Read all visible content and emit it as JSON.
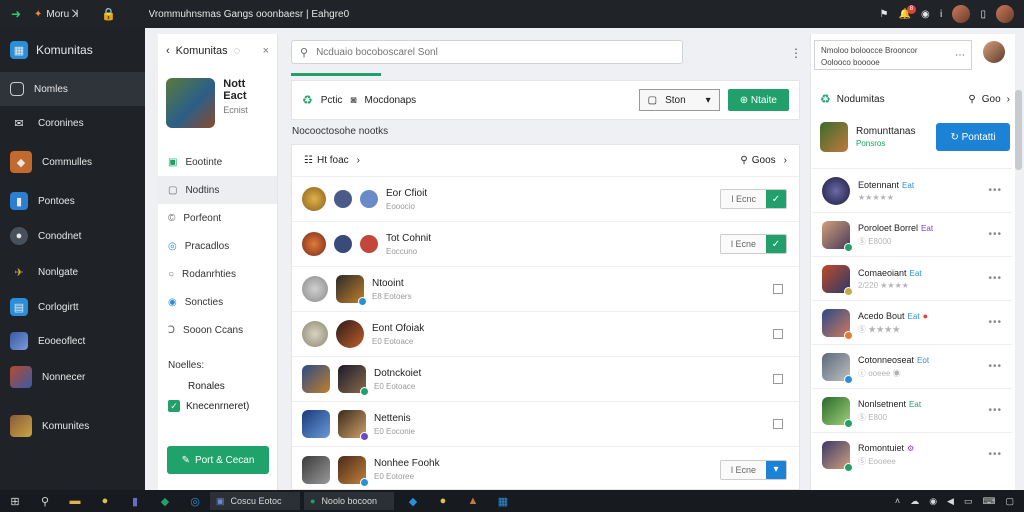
{
  "browser": {
    "app_name": "Moru ꓘ",
    "url": "Vrommuhnsmas Gangs ooonbaesr | Eahgre0",
    "notification_count": "8"
  },
  "leftnav": {
    "brand": "Komunitas",
    "items": [
      {
        "label": "Nomles",
        "icon": "circle-outline-icon",
        "color": "#3a3f46"
      },
      {
        "label": "Coronines",
        "icon": "inbox-icon",
        "color": "#3a3f46"
      },
      {
        "label": "Commulles",
        "icon": "game-icon",
        "color": "#c2692d"
      },
      {
        "label": "Pontoes",
        "icon": "book-icon",
        "color": "#2a7fd0"
      },
      {
        "label": "Conodnet",
        "icon": "globe-icon",
        "color": "#4a5059"
      },
      {
        "label": "Nonlgate",
        "icon": "bird-icon",
        "color": "#c9a742"
      },
      {
        "label": "Corlogirtt",
        "icon": "clipboard-icon",
        "color": "#2a8fd8"
      },
      {
        "label": "Eooeoflect",
        "icon": "game-art-icon",
        "color": "#3a5aa8"
      },
      {
        "label": "Nonnecer",
        "icon": "game-art-icon",
        "color": "#b54a2a"
      },
      {
        "label": "Komunites",
        "icon": "game-art-icon",
        "color": "#8a5a3a"
      }
    ]
  },
  "community": {
    "header": "Komunitas",
    "title": "Nott Eact",
    "subtitle": "Ecnist",
    "items": [
      {
        "label": "Eootinte",
        "icon": "grid-icon"
      },
      {
        "label": "Nodtins",
        "icon": "square-icon"
      },
      {
        "label": "Porfeont",
        "icon": "circle-c-icon"
      },
      {
        "label": "Pracadlos",
        "icon": "target-icon"
      },
      {
        "label": "Rodanrhties",
        "icon": "circle-outline-icon"
      },
      {
        "label": "Soncties",
        "icon": "circle-blue-icon"
      },
      {
        "label": "Sooon Ccans",
        "icon": "c-icon"
      }
    ],
    "section_label": "Noelles:",
    "option_1": "Ronales",
    "option_2": "Knecenrneret)",
    "button": "Port & Cecan"
  },
  "main": {
    "search_placeholder": "Ncduaio bocoboscarel Sonl",
    "toolbar_label": "Pctic",
    "toolbar_label_2": "Mocdonaps",
    "select_value": "Ston",
    "toolbar_button": "Ntaite",
    "section_title": "Nocooctosohe nootks",
    "list_header_left": "Ht foac",
    "list_header_right": "Goos",
    "rows": [
      {
        "name": "Eor Cfioit",
        "sub": "Eooocio",
        "control": "pill",
        "pill_label": "l Ecnc",
        "checked": true
      },
      {
        "name": "Tot Cohnit",
        "sub": "Eoccuno",
        "control": "pill",
        "pill_label": "l Ecne",
        "checked": true
      },
      {
        "name": "Ntooint",
        "sub": "E8 Eotoers",
        "control": "checkbox"
      },
      {
        "name": "Eont Ofoiak",
        "sub": "E0 Eotoace",
        "control": "checkbox"
      },
      {
        "name": "Dotnckoiet",
        "sub": "E0 Eotoace",
        "control": "checkbox"
      },
      {
        "name": "Nettenis",
        "sub": "E0 Eoconie",
        "control": "checkbox"
      },
      {
        "name": "Nonhee Foohk",
        "sub": "E0 Eotoree",
        "control": "pill",
        "pill_label": "l Ecne",
        "checked": false
      }
    ]
  },
  "right": {
    "top_card_line1": "Nmoloo boloocce Brooncor",
    "top_card_line2": "Oolooco booooe",
    "header": "Nodumitas",
    "header_right": "Goo",
    "featured_title": "Romunttanas",
    "featured_sub": "Ponsros",
    "featured_button": "Pontatti",
    "items": [
      {
        "name": "Eotennant",
        "tag": "Eat",
        "sub": "★★★★★"
      },
      {
        "name": "Poroloet Borrel",
        "tag": "Eat",
        "sub": "Ⓢ E8000"
      },
      {
        "name": "Comaeoiant",
        "tag": "Eat",
        "sub": "2/220 ★★★★"
      },
      {
        "name": "Acedo Bout",
        "tag": "Eat",
        "sub": "Ⓢ ★★★★"
      },
      {
        "name": "Cotonneoseat",
        "tag": "Eot",
        "sub": "ⓒ ooeee ◉"
      },
      {
        "name": "Nonlsetnent",
        "tag": "Eat",
        "sub": "Ⓢ E800"
      },
      {
        "name": "Romontuiet",
        "tag": "⚙",
        "sub": "Ⓢ Eooeee"
      }
    ]
  },
  "taskbar": {
    "window_1": "Coscu Eotoc",
    "window_2": "Noolo bocoon"
  }
}
